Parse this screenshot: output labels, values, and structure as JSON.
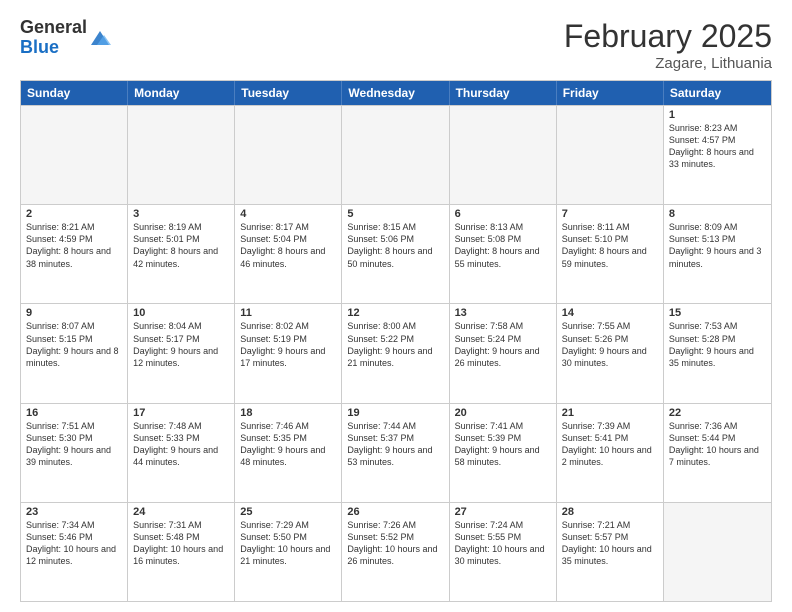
{
  "header": {
    "logo_general": "General",
    "logo_blue": "Blue",
    "month_title": "February 2025",
    "location": "Zagare, Lithuania"
  },
  "days_of_week": [
    "Sunday",
    "Monday",
    "Tuesday",
    "Wednesday",
    "Thursday",
    "Friday",
    "Saturday"
  ],
  "weeks": [
    [
      {
        "day": "",
        "info": ""
      },
      {
        "day": "",
        "info": ""
      },
      {
        "day": "",
        "info": ""
      },
      {
        "day": "",
        "info": ""
      },
      {
        "day": "",
        "info": ""
      },
      {
        "day": "",
        "info": ""
      },
      {
        "day": "1",
        "info": "Sunrise: 8:23 AM\nSunset: 4:57 PM\nDaylight: 8 hours and 33 minutes."
      }
    ],
    [
      {
        "day": "2",
        "info": "Sunrise: 8:21 AM\nSunset: 4:59 PM\nDaylight: 8 hours and 38 minutes."
      },
      {
        "day": "3",
        "info": "Sunrise: 8:19 AM\nSunset: 5:01 PM\nDaylight: 8 hours and 42 minutes."
      },
      {
        "day": "4",
        "info": "Sunrise: 8:17 AM\nSunset: 5:04 PM\nDaylight: 8 hours and 46 minutes."
      },
      {
        "day": "5",
        "info": "Sunrise: 8:15 AM\nSunset: 5:06 PM\nDaylight: 8 hours and 50 minutes."
      },
      {
        "day": "6",
        "info": "Sunrise: 8:13 AM\nSunset: 5:08 PM\nDaylight: 8 hours and 55 minutes."
      },
      {
        "day": "7",
        "info": "Sunrise: 8:11 AM\nSunset: 5:10 PM\nDaylight: 8 hours and 59 minutes."
      },
      {
        "day": "8",
        "info": "Sunrise: 8:09 AM\nSunset: 5:13 PM\nDaylight: 9 hours and 3 minutes."
      }
    ],
    [
      {
        "day": "9",
        "info": "Sunrise: 8:07 AM\nSunset: 5:15 PM\nDaylight: 9 hours and 8 minutes."
      },
      {
        "day": "10",
        "info": "Sunrise: 8:04 AM\nSunset: 5:17 PM\nDaylight: 9 hours and 12 minutes."
      },
      {
        "day": "11",
        "info": "Sunrise: 8:02 AM\nSunset: 5:19 PM\nDaylight: 9 hours and 17 minutes."
      },
      {
        "day": "12",
        "info": "Sunrise: 8:00 AM\nSunset: 5:22 PM\nDaylight: 9 hours and 21 minutes."
      },
      {
        "day": "13",
        "info": "Sunrise: 7:58 AM\nSunset: 5:24 PM\nDaylight: 9 hours and 26 minutes."
      },
      {
        "day": "14",
        "info": "Sunrise: 7:55 AM\nSunset: 5:26 PM\nDaylight: 9 hours and 30 minutes."
      },
      {
        "day": "15",
        "info": "Sunrise: 7:53 AM\nSunset: 5:28 PM\nDaylight: 9 hours and 35 minutes."
      }
    ],
    [
      {
        "day": "16",
        "info": "Sunrise: 7:51 AM\nSunset: 5:30 PM\nDaylight: 9 hours and 39 minutes."
      },
      {
        "day": "17",
        "info": "Sunrise: 7:48 AM\nSunset: 5:33 PM\nDaylight: 9 hours and 44 minutes."
      },
      {
        "day": "18",
        "info": "Sunrise: 7:46 AM\nSunset: 5:35 PM\nDaylight: 9 hours and 48 minutes."
      },
      {
        "day": "19",
        "info": "Sunrise: 7:44 AM\nSunset: 5:37 PM\nDaylight: 9 hours and 53 minutes."
      },
      {
        "day": "20",
        "info": "Sunrise: 7:41 AM\nSunset: 5:39 PM\nDaylight: 9 hours and 58 minutes."
      },
      {
        "day": "21",
        "info": "Sunrise: 7:39 AM\nSunset: 5:41 PM\nDaylight: 10 hours and 2 minutes."
      },
      {
        "day": "22",
        "info": "Sunrise: 7:36 AM\nSunset: 5:44 PM\nDaylight: 10 hours and 7 minutes."
      }
    ],
    [
      {
        "day": "23",
        "info": "Sunrise: 7:34 AM\nSunset: 5:46 PM\nDaylight: 10 hours and 12 minutes."
      },
      {
        "day": "24",
        "info": "Sunrise: 7:31 AM\nSunset: 5:48 PM\nDaylight: 10 hours and 16 minutes."
      },
      {
        "day": "25",
        "info": "Sunrise: 7:29 AM\nSunset: 5:50 PM\nDaylight: 10 hours and 21 minutes."
      },
      {
        "day": "26",
        "info": "Sunrise: 7:26 AM\nSunset: 5:52 PM\nDaylight: 10 hours and 26 minutes."
      },
      {
        "day": "27",
        "info": "Sunrise: 7:24 AM\nSunset: 5:55 PM\nDaylight: 10 hours and 30 minutes."
      },
      {
        "day": "28",
        "info": "Sunrise: 7:21 AM\nSunset: 5:57 PM\nDaylight: 10 hours and 35 minutes."
      },
      {
        "day": "",
        "info": ""
      }
    ]
  ]
}
